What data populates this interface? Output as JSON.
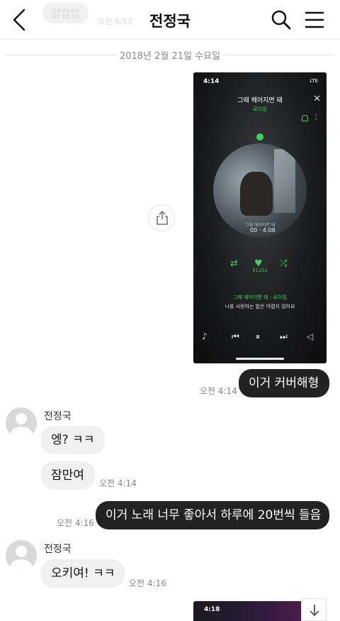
{
  "header": {
    "title": "전정국",
    "back_icon": "back-arrow-icon",
    "search_icon": "search-icon",
    "menu_icon": "hamburger-menu-icon"
  },
  "ghost_message": {
    "text": "압압압",
    "meta": "오전 4:53"
  },
  "date_separator": "2018년 2월 21일 수요일",
  "shared_media": {
    "status_time": "4:14",
    "status_network": "LTE",
    "song_title": "그때 헤어지면 돼",
    "artist": "로이킴",
    "art_time": "00 · 4:08",
    "art_lyric": "그때 헤어지면 돼",
    "likes": "61,152",
    "lyric_title": "그때 헤어지면 돼 - 로이킴",
    "lyric_line": "나를 사랑하는 법은 어렵지 않아요",
    "accent": "#3ed35a"
  },
  "share_button": {
    "icon": "share-icon"
  },
  "messages": [
    {
      "id": "m1",
      "from": "me",
      "text": "이거 커버해형",
      "time": "오전 4:14"
    },
    {
      "id": "m2",
      "from": "them",
      "sender": "전정국",
      "text": "엥? ㅋㅋ"
    },
    {
      "id": "m3",
      "from": "them",
      "text": "잠만여",
      "time": "오전 4:14"
    },
    {
      "id": "m4",
      "from": "me",
      "text": "이거 노래 너무 좋아서 하루에 20번씩 들음",
      "time": "오전 4:16"
    },
    {
      "id": "m5",
      "from": "them",
      "sender": "전정국",
      "text": "오키여! ㅋㅋ",
      "time": "오전 4:16"
    }
  ],
  "next_media": {
    "status_time": "4:18"
  },
  "scroll_down": {
    "icon": "arrow-down-icon"
  },
  "colors": {
    "my_bubble": "#222222",
    "their_bubble": "#f0f0f0",
    "accent_green": "#3ed35a"
  }
}
